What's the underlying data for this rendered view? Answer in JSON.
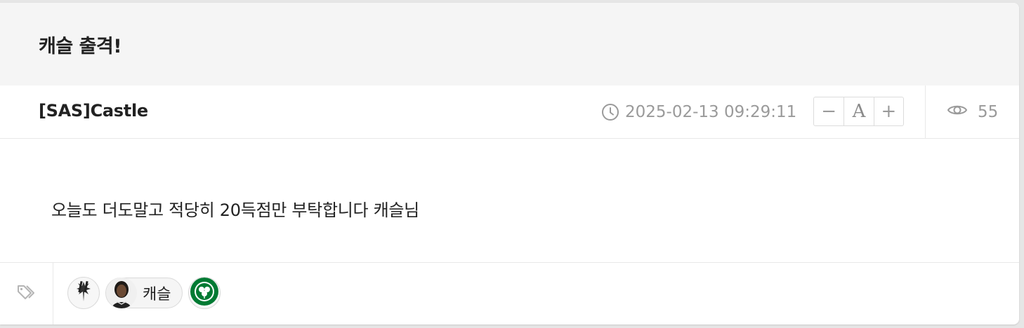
{
  "post": {
    "title": "캐슬 출격!",
    "author": "[SAS]Castle",
    "datetime": "2025-02-13 09:29:11",
    "views": "55",
    "body": "오늘도 더도말고 적당히 20득점만 부탁합니다 캐슬님"
  },
  "font_controls": {
    "decrease": "−",
    "font": "A",
    "increase": "+"
  },
  "tags": [
    {
      "type": "team",
      "icon": "spurs-logo"
    },
    {
      "type": "player",
      "icon": "player-avatar",
      "label": "캐슬"
    },
    {
      "type": "team",
      "icon": "celtics-logo"
    }
  ],
  "colors": {
    "title_bg": "#f5f5f5",
    "meta_text": "#9a9a9a",
    "celtics_green": "#007a33"
  }
}
